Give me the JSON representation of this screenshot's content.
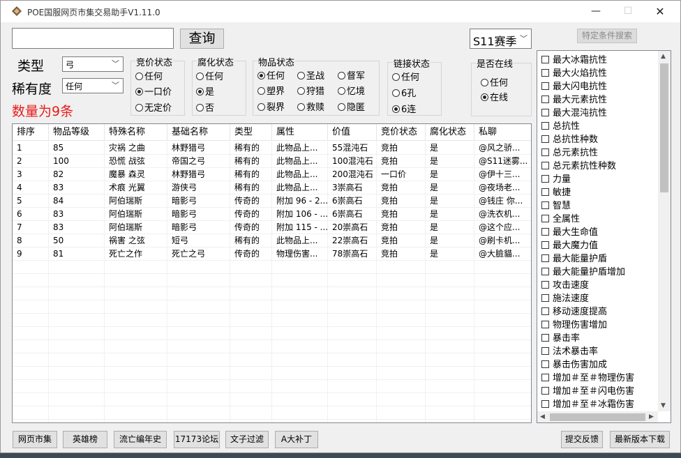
{
  "window": {
    "title": "POE国服网页市集交易助手V1.11.0",
    "min": "—",
    "max": "☐",
    "close": "✕"
  },
  "search": {
    "value": "",
    "placeholder": "",
    "query_label": "查询"
  },
  "season": {
    "selected": "S11赛季"
  },
  "special_search_label": "特定条件搜索",
  "type": {
    "label": "类型",
    "selected": "弓"
  },
  "rarity": {
    "label": "稀有度",
    "selected": "任何"
  },
  "count_text": "数量为9条",
  "groups": {
    "bid": {
      "label": "竞价状态",
      "options": [
        "任何",
        "一口价",
        "无定价"
      ],
      "selected": 1
    },
    "corrupt": {
      "label": "腐化状态",
      "options": [
        "任何",
        "是",
        "否"
      ],
      "selected": 1
    },
    "item": {
      "label": "物品状态",
      "options": [
        "任何",
        "圣战",
        "督军",
        "塑界",
        "狩猎",
        "忆境",
        "裂界",
        "救赎",
        "隐匿"
      ],
      "selected": 0
    },
    "link": {
      "label": "链接状态",
      "options": [
        "任何",
        "6孔",
        "6连"
      ],
      "selected": 2
    },
    "online": {
      "label": "是否在线",
      "options": [
        "任何",
        "在线"
      ],
      "selected": 1
    }
  },
  "table": {
    "headers": [
      "排序",
      "物品等级",
      "特殊名称",
      "基础名称",
      "类型",
      "属性",
      "价值",
      "竞价状态",
      "腐化状态",
      "私聊"
    ],
    "rows": [
      [
        "1",
        "85",
        "灾祸 之曲",
        "林野猎弓",
        "稀有的",
        "此物品上...",
        "55混沌石",
        "竞拍",
        "是",
        "@风之骄..."
      ],
      [
        "2",
        "100",
        "恐慌 战弦",
        "帝国之弓",
        "稀有的",
        "此物品上...",
        "100混沌石",
        "竞拍",
        "是",
        "@S11迷雾..."
      ],
      [
        "3",
        "82",
        "魔暴 森灵",
        "林野猎弓",
        "稀有的",
        "此物品上...",
        "200混沌石",
        "一口价",
        "是",
        "@伊十三..."
      ],
      [
        "4",
        "83",
        "术痕 光翼",
        "游侠弓",
        "稀有的",
        "此物品上...",
        "3崇高石",
        "竞拍",
        "是",
        "@夜场老..."
      ],
      [
        "5",
        "84",
        "阿伯瑞斯",
        "暗影弓",
        "传奇的",
        "附加 96 - 2...",
        "6崇高石",
        "竞拍",
        "是",
        "@钱庄 你..."
      ],
      [
        "6",
        "83",
        "阿伯瑞斯",
        "暗影弓",
        "传奇的",
        "附加 106 - ...",
        "6崇高石",
        "竞拍",
        "是",
        "@洗衣机..."
      ],
      [
        "7",
        "83",
        "阿伯瑞斯",
        "暗影弓",
        "传奇的",
        "附加 115 - ...",
        "20崇高石",
        "竞拍",
        "是",
        "@这个应..."
      ],
      [
        "8",
        "50",
        "祸害 之弦",
        "短弓",
        "稀有的",
        "此物品上...",
        "22崇高石",
        "竞拍",
        "是",
        "@刷卡机..."
      ],
      [
        "9",
        "81",
        "死亡之作",
        "死亡之弓",
        "传奇的",
        "物理伤害...",
        "78崇高石",
        "竞拍",
        "是",
        "@大臉貓..."
      ]
    ]
  },
  "conditions": [
    "最大冰霜抗性",
    "最大火焰抗性",
    "最大闪电抗性",
    "最大元素抗性",
    "最大混沌抗性",
    "总抗性",
    "总抗性种数",
    "总元素抗性",
    "总元素抗性种数",
    "力量",
    "敏捷",
    "智慧",
    "全属性",
    "最大生命值",
    "最大魔力值",
    "最大能量护盾",
    "最大能量护盾增加",
    "攻击速度",
    "施法速度",
    "移动速度提高",
    "物理伤害增加",
    "暴击率",
    "法术暴击率",
    "暴击伤害加成",
    "增加＃至＃物理伤害",
    "增加＃至＃闪电伤害",
    "增加＃至＃冰霜伤害"
  ],
  "bottom_buttons": [
    "网页市集",
    "英雄榜",
    "流亡编年史",
    "17173论坛",
    "文子过滤",
    "A大补丁",
    "提交反馈",
    "最新版本下载"
  ]
}
